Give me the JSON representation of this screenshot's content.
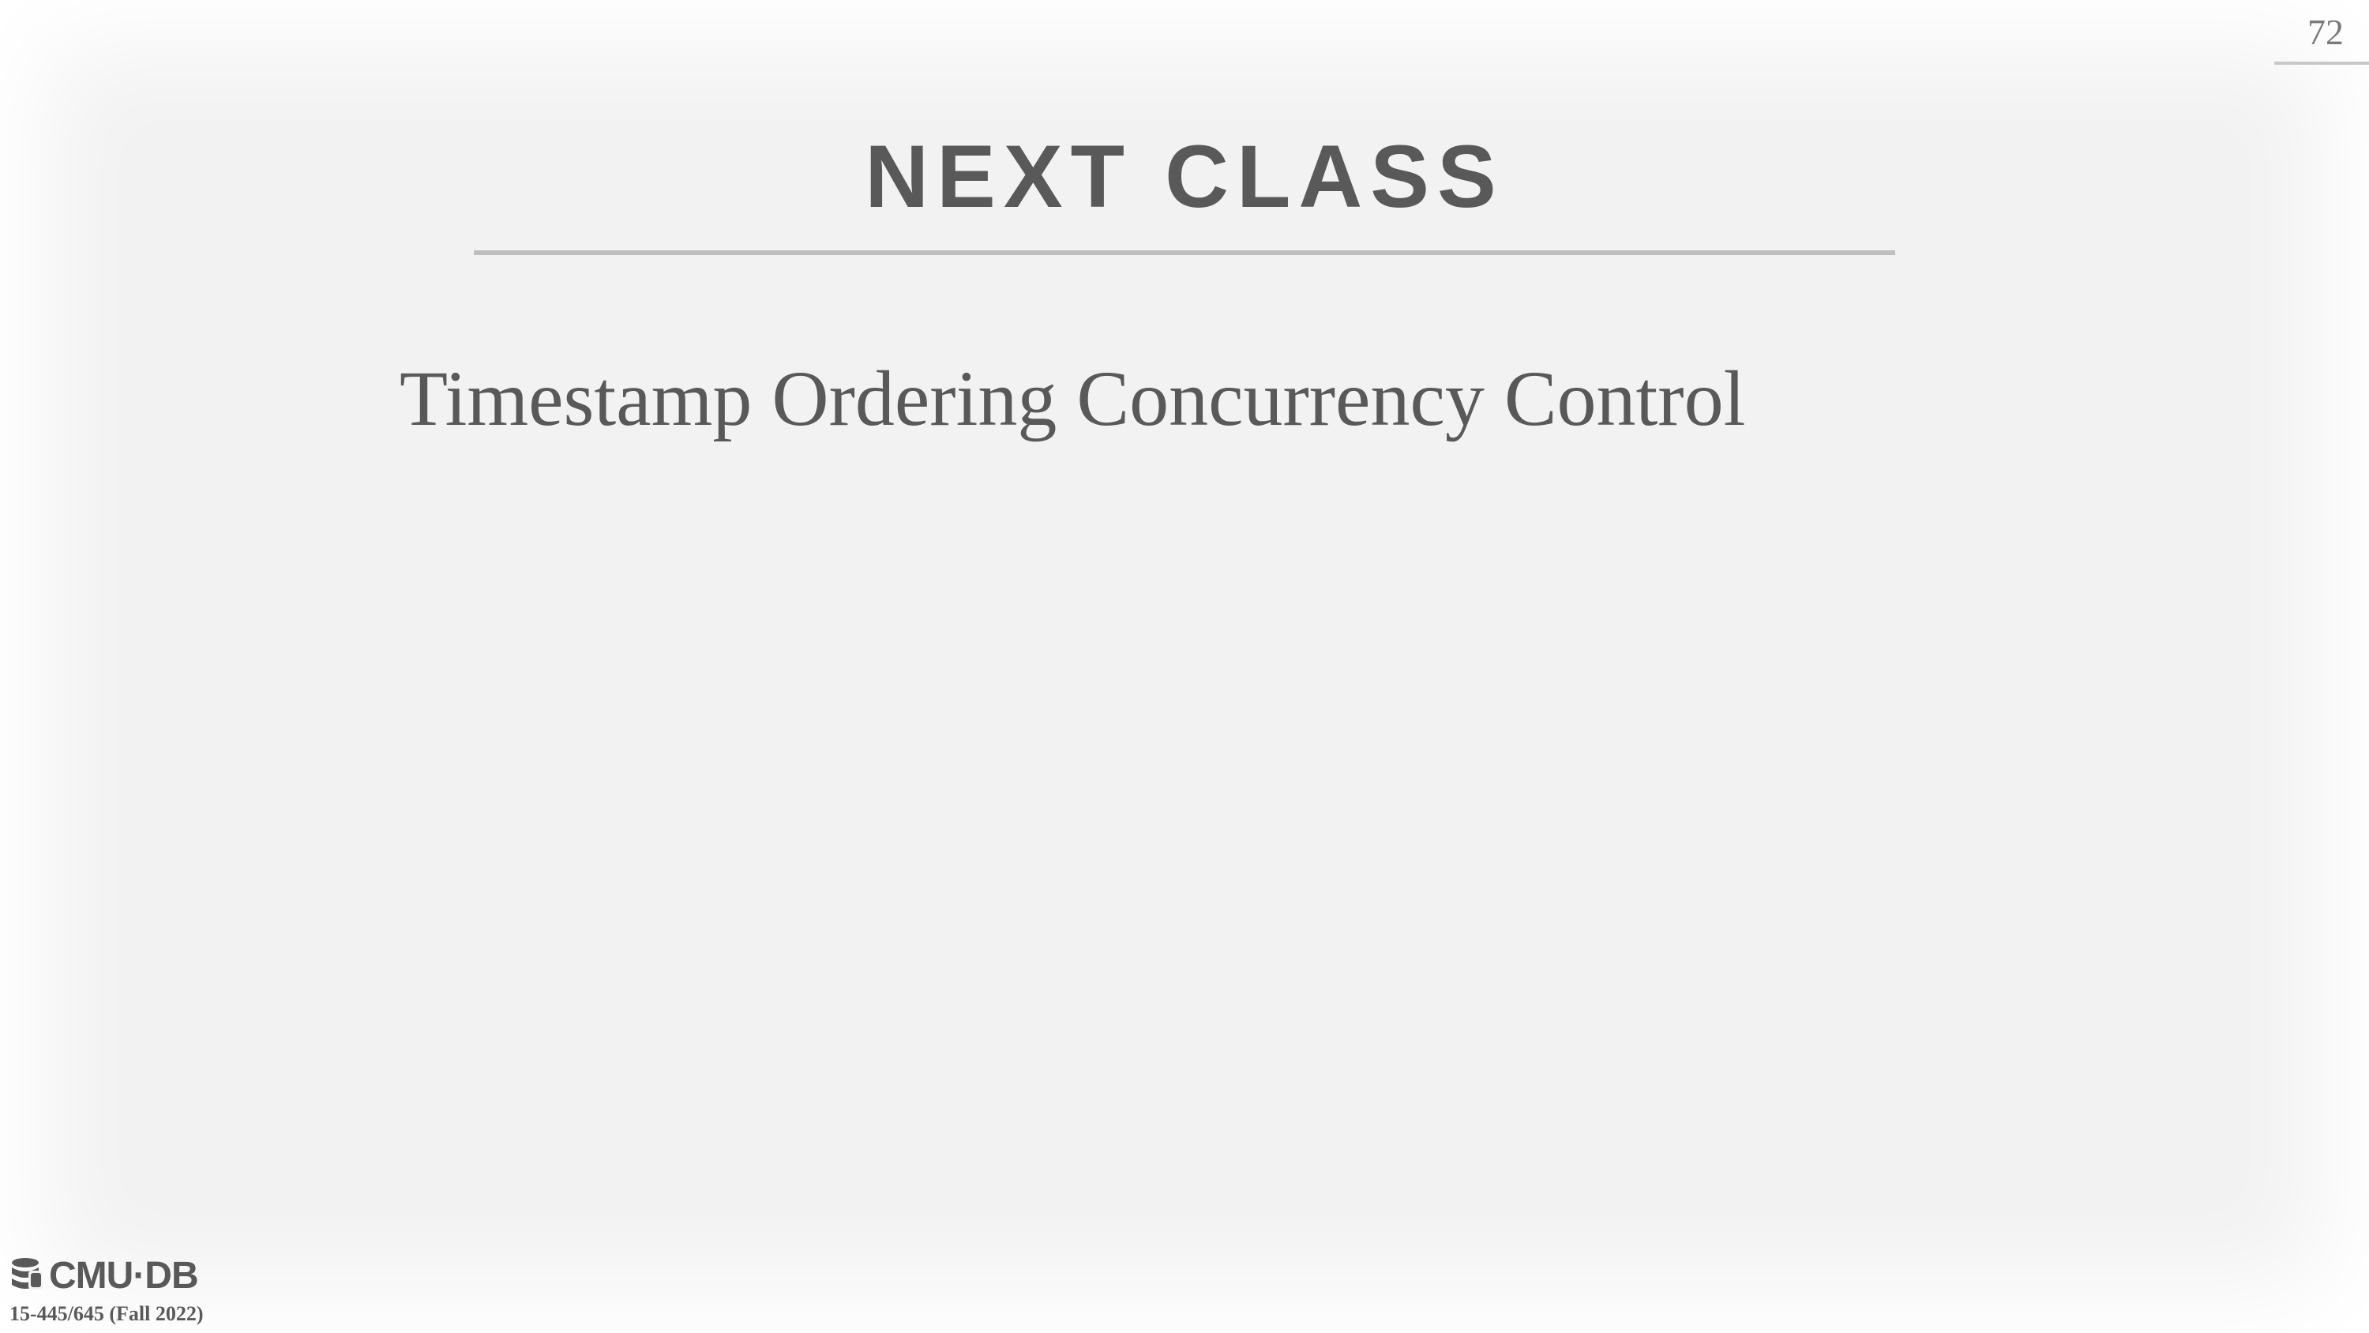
{
  "slide": {
    "page_number": "72",
    "title": "NEXT CLASS",
    "body": "Timestamp Ordering Concurrency Control"
  },
  "footer": {
    "logo_text": "CMU·DB",
    "course": "15-445/645 (Fall 2022)",
    "logo_icon": "database-stack-icon"
  },
  "colors": {
    "background": "#f2f2f2",
    "text": "#595959",
    "rule": "#bfbfbf"
  }
}
